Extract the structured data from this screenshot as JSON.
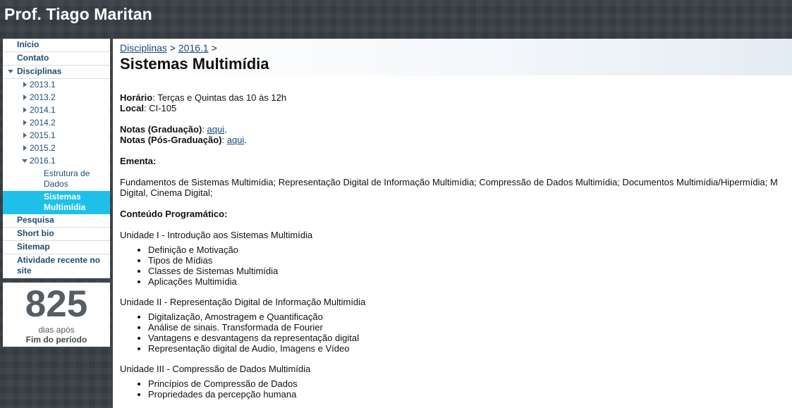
{
  "site": {
    "title": "Prof. Tiago Maritan"
  },
  "sidebar": {
    "items": [
      {
        "label": "Início"
      },
      {
        "label": "Contato"
      },
      {
        "label": "Disciplinas"
      },
      {
        "label": "2013.1"
      },
      {
        "label": "2013.2"
      },
      {
        "label": "2014.1"
      },
      {
        "label": "2014.2"
      },
      {
        "label": "2015.1"
      },
      {
        "label": "2015.2"
      },
      {
        "label": "2016.1"
      },
      {
        "label": "Estrutura de Dados"
      },
      {
        "label": "Sistemas Multimídia"
      },
      {
        "label": "Pesquisa"
      },
      {
        "label": "Short bio"
      },
      {
        "label": "Sitemap"
      },
      {
        "label": "Atividade recente no site"
      }
    ],
    "counter": {
      "number": "825",
      "line1": "dias após",
      "line2": "Fim do período"
    }
  },
  "breadcrumb": {
    "link1": "Disciplinas",
    "sep1": " > ",
    "link2": "2016.1",
    "sep2": " >"
  },
  "page": {
    "title": "Sistemas Multimídia",
    "horario_label": "Horário",
    "horario_value": ": Terças e Quintas das 10 às 12h",
    "local_label": "Local",
    "local_value": ": CI-105",
    "notas_grad_label": "Notas (Graduação)",
    "notas_grad_sep": ": ",
    "notas_grad_link": "aqui",
    "notas_grad_end": ".",
    "notas_pos_label": "Notas (Pós-Graduação)",
    "notas_pos_sep": ": ",
    "notas_pos_link": "aqui",
    "notas_pos_end": ".",
    "ementa_label": "Ementa:",
    "ementa_text": "Fundamentos de Sistemas Multimídia; Representação Digital de Informação Multimídia; Compressão de Dados Multimídia; Documentos Multimídia/Hipermídia; M Digital, Cinema Digital;",
    "conteudo_label": "Conteúdo Programático:",
    "units": [
      {
        "title": "Unidade I - Introdução aos Sistemas Multimídia",
        "topics": [
          "Definição e Motivação",
          "Tipos de Mídias",
          "Classes de Sistemas Multimídia",
          "Aplicações Multimídia"
        ]
      },
      {
        "title": "Unidade II - Representação Digital de Informação Multimídia",
        "topics": [
          "Digitalização, Amostragem e Quantificação",
          "Análise de sinais. Transformada de Fourier",
          "Vantagens e desvantagens da representação digital",
          "Representação digital de Audio, Imagens e Vídeo"
        ]
      },
      {
        "title": "Unidade III - Compressão de Dados Multimídia",
        "topics": [
          "Princípios de Compressão de Dados",
          "Propriedades da percepção humana"
        ]
      }
    ]
  }
}
